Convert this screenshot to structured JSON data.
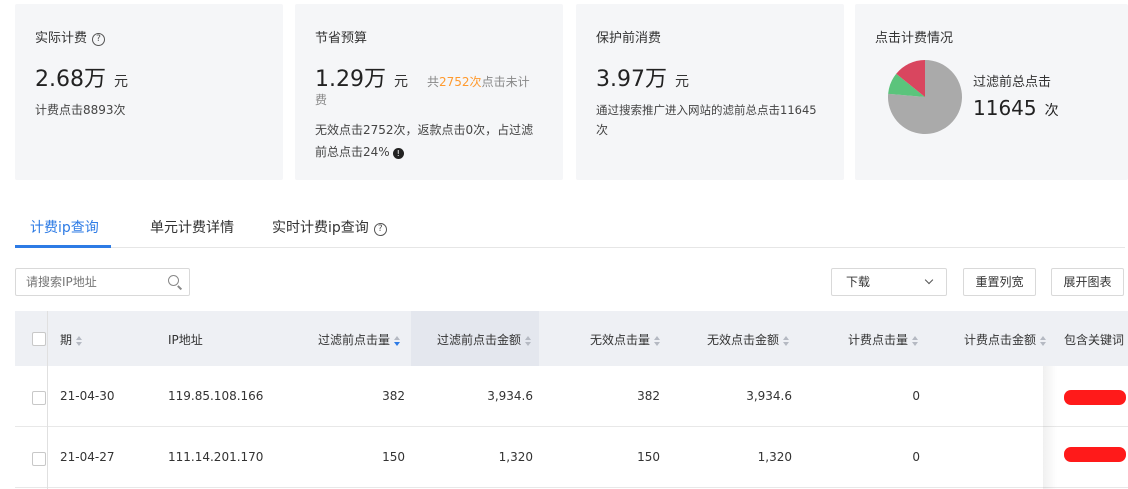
{
  "cards": {
    "actual": {
      "title": "实际计费",
      "value": "2.68万",
      "unit": "元",
      "sub": "计费点击8893次"
    },
    "saved": {
      "title": "节省预算",
      "value": "1.29万",
      "unit": "元",
      "note_pre": "共",
      "note_num": "2752次",
      "note_post": "点击未计",
      "note_tail": "费",
      "desc_line1": "无效点击2752次，返款点击0次，占过滤",
      "desc_line2": "前总点击24%"
    },
    "before": {
      "title": "保护前消费",
      "value": "3.97万",
      "unit": "元",
      "desc_line1": "通过搜索推广进入网站的滤前总点击11645",
      "desc_line2": "次"
    },
    "clicks": {
      "title": "点击计费情况",
      "label": "过滤前总点击",
      "value": "11645",
      "unit": "次"
    }
  },
  "chart_data": {
    "type": "pie",
    "slices": [
      {
        "value": 8893,
        "color": "#aaaaaa"
      },
      {
        "value": 1100,
        "color": "#5bc47c"
      },
      {
        "value": 1652,
        "color": "#d9465f"
      }
    ]
  },
  "tabs": [
    {
      "label": "计费ip查询",
      "active": true
    },
    {
      "label": "单元计费详情",
      "active": false
    },
    {
      "label": "实时计费ip查询",
      "active": false
    }
  ],
  "toolbar": {
    "search_placeholder": "请搜索IP地址",
    "download_label": "下载",
    "reset_label": "重置列宽",
    "expand_label": "展开图表"
  },
  "table": {
    "headers": {
      "date": "期",
      "ip": "IP地址",
      "pre_clicks": "过滤前点击量",
      "pre_amount": "过滤前点击金额",
      "invalid_clicks": "无效点击量",
      "invalid_amount": "无效点击金额",
      "billed_clicks": "计费点击量",
      "billed_amount": "计费点击金额",
      "keywords": "包含关键词"
    },
    "rows": [
      {
        "date": "21-04-30",
        "ip": "119.85.108.166",
        "pre_clicks": "382",
        "pre_amount": "3,934.6",
        "invalid_clicks": "382",
        "invalid_amount": "3,934.6",
        "billed_clicks": "0"
      },
      {
        "date": "21-04-27",
        "ip": "111.14.201.170",
        "pre_clicks": "150",
        "pre_amount": "1,320",
        "invalid_clicks": "150",
        "invalid_amount": "1,320",
        "billed_clicks": "0"
      }
    ]
  },
  "colors": {
    "accent": "#2d7be5",
    "highlight": "#ff9a2e"
  }
}
